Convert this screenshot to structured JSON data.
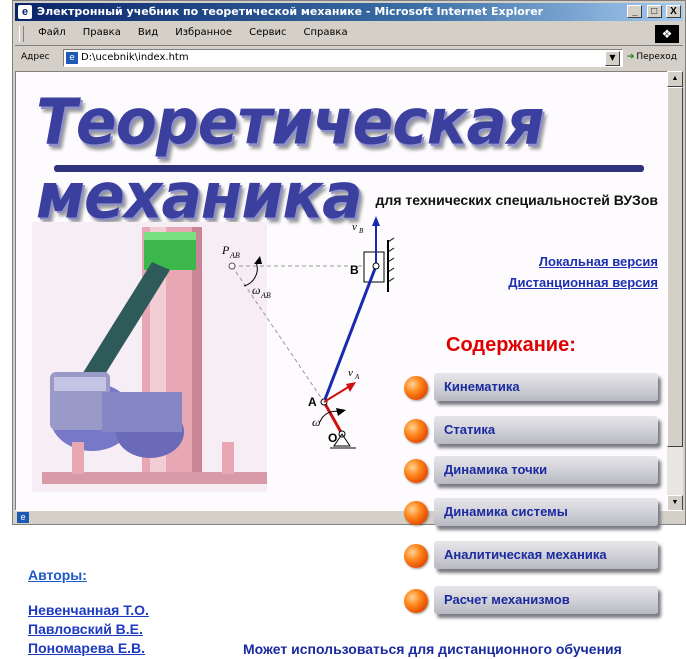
{
  "window": {
    "title": "Электронный учебник по теоретической механике - Microsoft Internet Explorer",
    "buttons": [
      "_",
      "□",
      "X"
    ]
  },
  "menubar": {
    "items": [
      "Файл",
      "Правка",
      "Вид",
      "Избранное",
      "Сервис",
      "Справка"
    ]
  },
  "addressbar": {
    "label": "Адрес",
    "value": "D:\\ucebnik\\index.htm",
    "go_label": "Переход"
  },
  "page": {
    "title": "Теоретическая механика",
    "subtitle": "для технических специальностей ВУЗов",
    "links": {
      "local": "Локальная версия",
      "distance": "Дистанционная версия"
    },
    "contents_heading": "Содержание:",
    "menu": [
      "Кинематика",
      "Статика",
      "Динамика точки",
      "Динамика системы",
      "Аналитическая механика",
      "Расчет механизмов"
    ],
    "diagram_labels": {
      "p_ab": "P",
      "p_ab_sub": "AB",
      "omega_ab": "ω",
      "omega_ab_sub": "AB",
      "v_b": "v",
      "v_b_sub": "B",
      "v_a": "v",
      "v_a_sub": "A",
      "point_b": "B",
      "point_a": "A",
      "point_o": "O",
      "omega": "ω"
    }
  },
  "authors": {
    "label": "Авторы:",
    "names": [
      "Невенчанная Т.О.",
      "Павловский В.Е.",
      "Пономарева Е.В."
    ]
  },
  "footer_note": "Может использоваться для дистанционного обучения",
  "colors": {
    "title_blue": "#3b3f9e",
    "heading_red": "#e00000",
    "link_blue": "#1d2fb0",
    "bullet_orange": "#ff8a1e"
  }
}
